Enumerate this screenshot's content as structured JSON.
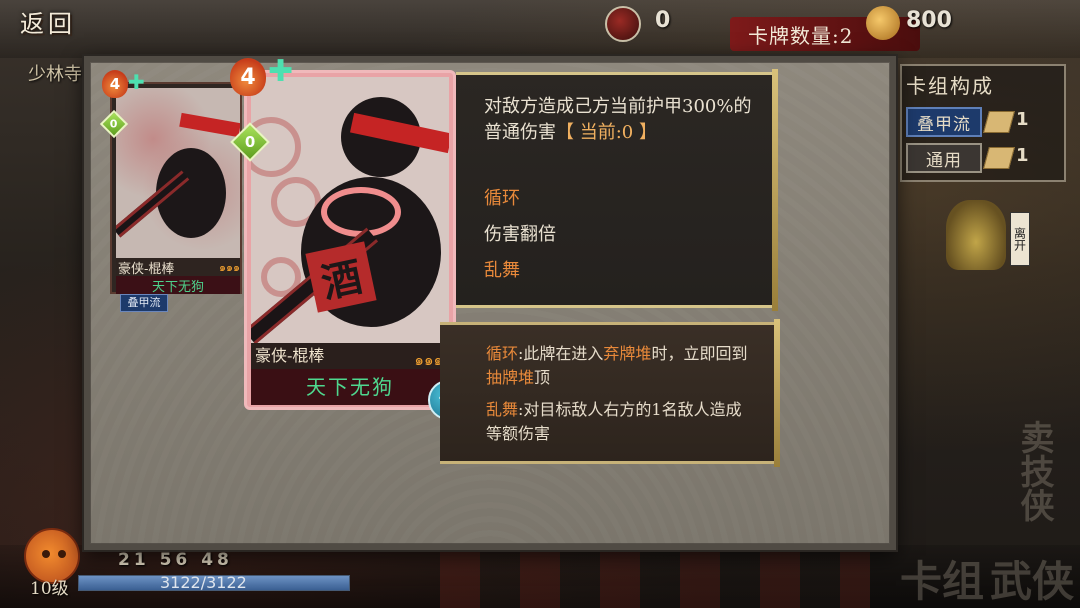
{
  "header": {
    "back_label": "返回",
    "location": "少林寺",
    "coin_value": "0",
    "deck_count": "卡牌数量:2",
    "gold_value": "800"
  },
  "deck_panel": {
    "title": "卡组构成",
    "rows": [
      {
        "label": "叠甲流",
        "count": "1"
      },
      {
        "label": "通用",
        "count": "1"
      }
    ]
  },
  "exit_widget": {
    "label": "离开"
  },
  "player": {
    "level": "10级",
    "stats": [
      "21",
      "56",
      "48"
    ],
    "hp_text": "3122/3122",
    "hp_fraction": 1.0
  },
  "small_card": {
    "cost": "4",
    "gem_value": "0",
    "name": "豪侠-棍棒",
    "flames": "๑๑๑",
    "title": "天下无狗",
    "tag": "叠甲流"
  },
  "big_card": {
    "cost": "4",
    "gem_value": "0",
    "seal_char": "酒",
    "name": "豪侠-棍棒",
    "flames": "๑๑๑",
    "title": "天下无狗",
    "rate_label": "评"
  },
  "description": {
    "main_prefix": "对敌方造成己方当前护甲300%的普通伤害",
    "main_highlight": "【 当前:0 】",
    "keywords": [
      "循环",
      "伤害翻倍",
      "乱舞"
    ]
  },
  "glossary": [
    {
      "term": "循环",
      "text_a": ":此牌在进入",
      "kw_a": "弃牌堆",
      "text_b": "时，立即回到",
      "kw_b": "抽牌堆",
      "text_c": "顶"
    },
    {
      "term": "乱舞",
      "text_a": ":对目标敌人右方的1名敌人造成等额伤害"
    }
  ],
  "background_text": {
    "right_deco": "卖技侠",
    "bottom_right": "卡组",
    "bottom_right2": "武侠"
  }
}
